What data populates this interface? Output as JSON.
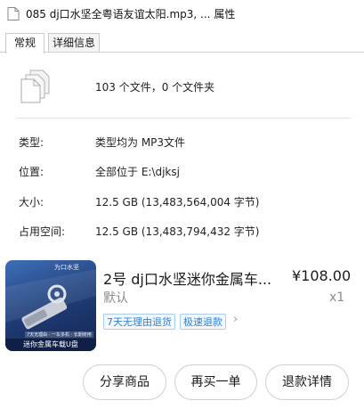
{
  "dialog": {
    "title": "085 dj口水坚全粤语友谊太阳.mp3, ... 属性",
    "tabs": [
      {
        "label": "常规",
        "active": true
      },
      {
        "label": "详细信息",
        "active": false
      }
    ],
    "file_icon": "multiple-files-icon",
    "summary": "103 个文件，0 个文件夹",
    "rows": [
      {
        "label": "类型:",
        "value": "类型均为 MP3文件"
      },
      {
        "label": "位置:",
        "value": "全部位于 E:\\djksj"
      },
      {
        "label": "大小:",
        "value": "12.5 GB (13,483,564,004 字节)"
      },
      {
        "label": "占用空间:",
        "value": "12.5 GB (13,483,794,432 字节)"
      }
    ]
  },
  "order": {
    "thumbnail": {
      "top_text": "为口水坚",
      "sub_text": "7天无理由 · 一车多机 · 长期使用",
      "caption": "迷你金属车载U盘"
    },
    "product_title": "2号  dj口水坚迷你金属车...",
    "price": "¥108.00",
    "variant": "默认",
    "quantity": "x1",
    "tags": [
      "7天无理由退货",
      "极速退款"
    ],
    "buttons": {
      "share": "分享商品",
      "rebuy": "再买一单",
      "refund": "退款详情"
    },
    "colors": {
      "tag_blue": "#2f7fd8"
    }
  }
}
